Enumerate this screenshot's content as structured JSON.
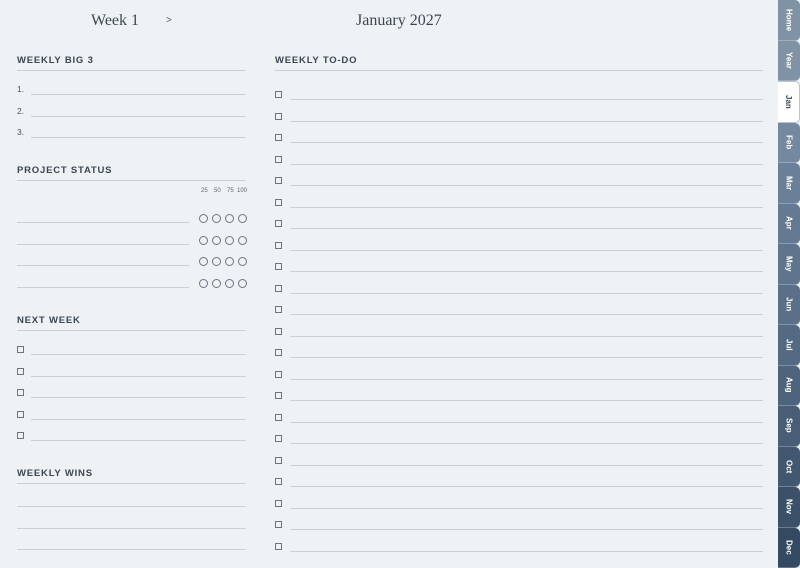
{
  "header": {
    "week_label": "Week 1",
    "next_arrow": ">",
    "month_label": "January 2027"
  },
  "big3": {
    "title": "WEEKLY BIG 3",
    "numbers": [
      "1.",
      "2.",
      "3."
    ]
  },
  "project_status": {
    "title": "PROJECT STATUS",
    "percent_labels": [
      "25",
      "50",
      "75",
      "100"
    ]
  },
  "next_week": {
    "title": "NEXT WEEK"
  },
  "weekly_wins": {
    "title": "WEEKLY WINS"
  },
  "todo": {
    "title": "WEEKLY TO-DO"
  },
  "tabs": {
    "labels": [
      "Home",
      "Year",
      "Jan",
      "Feb",
      "Mar",
      "Apr",
      "May",
      "Jun",
      "Jul",
      "Aug",
      "Sep",
      "Oct",
      "Nov",
      "Dec"
    ],
    "active": "Jan",
    "colors": [
      "#7f93a5",
      "#7f93a5",
      "#ffffff",
      "#7489a0",
      "#6a8099",
      "#647a93",
      "#5f758e",
      "#5a7088",
      "#546a82",
      "#4e647c",
      "#485e76",
      "#425870",
      "#3b5169",
      "#344a62"
    ]
  },
  "colors": {
    "background": "#eef2f5",
    "rule": "#c9d1d8",
    "text": "#3b4652"
  }
}
